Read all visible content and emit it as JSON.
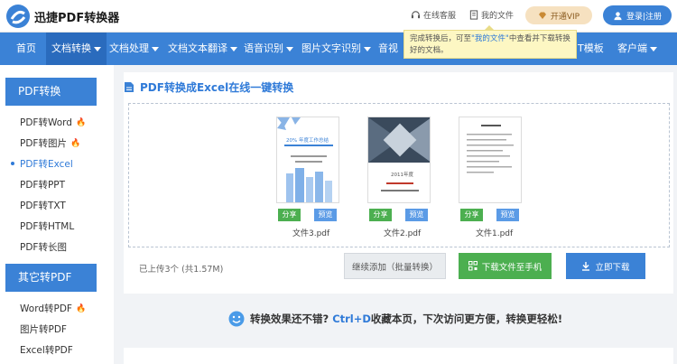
{
  "header": {
    "brand": "迅捷PDF转换器",
    "service": "在线客服",
    "my_files": "我的文件",
    "vip": "开通VIP",
    "login": "登录|注册"
  },
  "nav": {
    "items": [
      "首页",
      "文档转换",
      "文档处理",
      "文档文本翻译",
      "语音识别",
      "图片文字识别",
      "音视",
      "T模板",
      "客户端"
    ]
  },
  "tooltip": {
    "part1": "完成转换后，可至",
    "link": "\"我的文件\"",
    "part2": "中查看并下载转换好的文档。"
  },
  "sidebar": {
    "group1_title": "PDF转换",
    "group1_items": [
      "PDF转Word",
      "PDF转图片",
      "PDF转Excel",
      "PDF转PPT",
      "PDF转TXT",
      "PDF转HTML",
      "PDF转长图"
    ],
    "group2_title": "其它转PDF",
    "group2_items": [
      "Word转PDF",
      "图片转PDF",
      "Excel转PDF"
    ]
  },
  "main": {
    "title": "PDF转换成Excel在线一键转换",
    "files": [
      {
        "name": "文件3.pdf",
        "share": "分享",
        "preview": "预览",
        "thumb_title": "20% 年度工作总结"
      },
      {
        "name": "文件2.pdf",
        "share": "分享",
        "preview": "预览",
        "thumb_title": "2011年度"
      },
      {
        "name": "文件1.pdf",
        "share": "分享",
        "preview": "预览",
        "thumb_title": ""
      }
    ],
    "uploaded": "已上传3个 (共1.57M)",
    "add_btn": "继续添加（批量转换）",
    "phone_btn": "下载文件至手机",
    "download_btn": "立即下载"
  },
  "promo": {
    "part1": "转换效果还不错?",
    "hotkey": "Ctrl+D",
    "part2": "收藏本页，下次访问更方便，转换更轻松!"
  },
  "colors": {
    "accent": "#3b82d6",
    "green": "#4caf50",
    "vip": "#f6e1c0"
  }
}
